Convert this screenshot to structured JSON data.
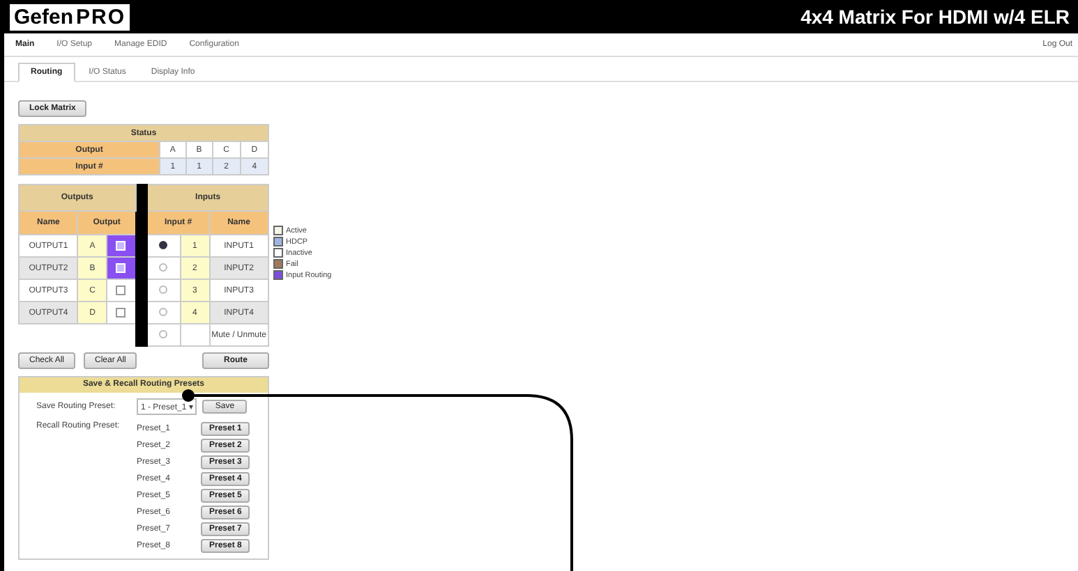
{
  "header": {
    "logo_left": "Gefen",
    "logo_right": "PRO",
    "title": "4x4 Matrix For HDMI w/4 ELR"
  },
  "menu": [
    {
      "label": "Main",
      "selected": true
    },
    {
      "label": "I/O Setup",
      "selected": false
    },
    {
      "label": "Manage EDID",
      "selected": false
    },
    {
      "label": "Configuration",
      "selected": false
    }
  ],
  "logout": "Log Out",
  "tabs": [
    {
      "label": "Routing",
      "selected": true
    },
    {
      "label": "I/O Status",
      "selected": false
    },
    {
      "label": "Display Info",
      "selected": false
    }
  ],
  "lock_button": "Lock Matrix",
  "status": {
    "title": "Status",
    "output_label": "Output",
    "outputs": [
      "A",
      "B",
      "C",
      "D"
    ],
    "input_label": "Input #",
    "inputs": [
      "1",
      "1",
      "2",
      "4"
    ]
  },
  "routing": {
    "outputs_title": "Outputs",
    "inputs_title": "Inputs",
    "col_name": "Name",
    "col_output": "Output",
    "col_input": "Input #",
    "col_input_name": "Name",
    "rows": [
      {
        "output_name": "OUTPUT1",
        "output_letter": "A",
        "checked": true,
        "radio_selected": true,
        "input_number": "1",
        "input_name": "INPUT1"
      },
      {
        "output_name": "OUTPUT2",
        "output_letter": "B",
        "checked": true,
        "radio_selected": false,
        "input_number": "2",
        "input_name": "INPUT2"
      },
      {
        "output_name": "OUTPUT3",
        "output_letter": "C",
        "checked": false,
        "radio_selected": false,
        "input_number": "3",
        "input_name": "INPUT3"
      },
      {
        "output_name": "OUTPUT4",
        "output_letter": "D",
        "checked": false,
        "radio_selected": false,
        "input_number": "4",
        "input_name": "INPUT4"
      }
    ],
    "mute_row": {
      "radio_selected": false,
      "label": "Mute / Unmute"
    }
  },
  "legend": [
    {
      "label": "Active",
      "color": "#f4f4e8"
    },
    {
      "label": "HDCP",
      "color": "#9fb4e0"
    },
    {
      "label": "Inactive",
      "color": "#ffffff"
    },
    {
      "label": "Fail",
      "color": "#a0785a"
    },
    {
      "label": "Input Routing",
      "color": "#7a4fe0"
    }
  ],
  "buttons": {
    "check_all": "Check All",
    "clear_all": "Clear All",
    "route": "Route"
  },
  "presets": {
    "title": "Save & Recall Routing Presets",
    "save_label": "Save Routing Preset:",
    "save_select": "1 - Preset_1",
    "save_select_caret": "▾",
    "save_button": "Save",
    "recall_label": "Recall Routing Preset:",
    "items": [
      {
        "name": "Preset_1",
        "button": "Preset 1"
      },
      {
        "name": "Preset_2",
        "button": "Preset 2"
      },
      {
        "name": "Preset_3",
        "button": "Preset 3"
      },
      {
        "name": "Preset_4",
        "button": "Preset 4"
      },
      {
        "name": "Preset_5",
        "button": "Preset 5"
      },
      {
        "name": "Preset_6",
        "button": "Preset 6"
      },
      {
        "name": "Preset_7",
        "button": "Preset 7"
      },
      {
        "name": "Preset_8",
        "button": "Preset 8"
      }
    ]
  }
}
